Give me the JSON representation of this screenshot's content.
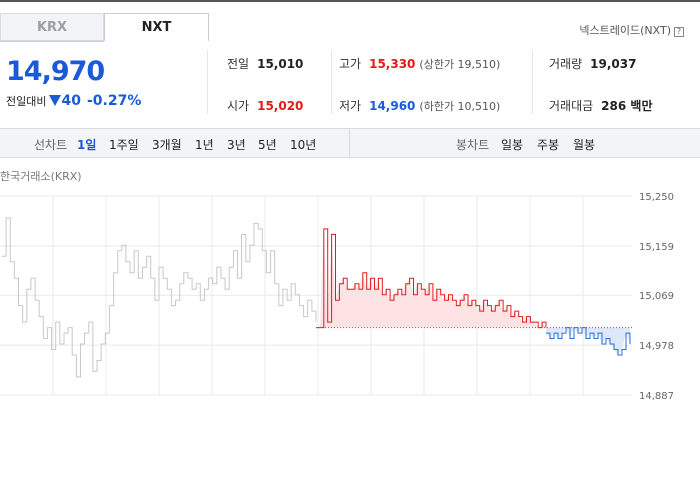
{
  "tabs": [
    {
      "label": "KRX",
      "active": false
    },
    {
      "label": "NXT",
      "active": true
    }
  ],
  "nxt_info_label": "넥스트레이드(NXT)",
  "help_icon_glyph": "?",
  "price": "14,970",
  "change": {
    "label": "전일대비",
    "amount": "40",
    "percent": "-0.27%",
    "direction": "down"
  },
  "stats": {
    "prev_close": {
      "label": "전일",
      "value": "15,010"
    },
    "high": {
      "label": "고가",
      "value": "15,330",
      "limit_label": "(상한가 19,510)"
    },
    "volume": {
      "label": "거래량",
      "value": "19,037"
    },
    "open": {
      "label": "시가",
      "value": "15,020"
    },
    "low": {
      "label": "저가",
      "value": "14,960",
      "limit_label": "(하한가 10,510)"
    },
    "amount": {
      "label": "거래대금",
      "value": "286 백만"
    }
  },
  "line_chart_menu": {
    "label": "선차트",
    "items": [
      {
        "label": "1일",
        "active": true
      },
      {
        "label": "1주일",
        "active": false
      },
      {
        "label": "3개월",
        "active": false
      },
      {
        "label": "1년",
        "active": false
      },
      {
        "label": "3년",
        "active": false
      },
      {
        "label": "5년",
        "active": false
      },
      {
        "label": "10년",
        "active": false
      }
    ]
  },
  "candle_chart_menu": {
    "label": "봉차트",
    "items": [
      {
        "label": "일봉"
      },
      {
        "label": "주봉"
      },
      {
        "label": "월봉"
      }
    ]
  },
  "chart_data": {
    "type": "line",
    "title": "한국거래소(KRX)",
    "ylim": [
      14887,
      15250
    ],
    "y_ticks": [
      "15,250",
      "15,159",
      "15,069",
      "14,978",
      "14,887"
    ],
    "y_tick_values": [
      15250,
      15159,
      15069,
      14978,
      14887
    ],
    "reference_price": 15010,
    "colors": {
      "krx": "#c8c8c8",
      "up": "#e21a1a",
      "down": "#2a6fd6",
      "up_fill": "#fde3e3",
      "down_fill": "#dde9f8",
      "grid": "#e9e9e9"
    },
    "series": [
      {
        "name": "",
        "values": [
          15140,
          15210,
          15130,
          15100,
          15050,
          15020,
          15080,
          15100,
          15060,
          15030,
          14990,
          15010,
          14970,
          15020,
          14980,
          15000,
          15010,
          14960,
          14920,
          14980,
          15000,
          15020,
          14930,
          14950,
          14980,
          15000,
          15050,
          15110,
          15150,
          15160,
          15130,
          15110,
          15150,
          15100,
          15120,
          15140,
          15100,
          15060,
          15120,
          15100,
          15080,
          15050,
          15060,
          15090,
          15110,
          15100,
          15080,
          15090,
          15060,
          15080,
          15100,
          15090,
          15120,
          15100,
          15080,
          15120,
          15150,
          15100,
          15180,
          15130,
          15160,
          15200,
          15190,
          15150,
          15110,
          15150,
          15090,
          15050,
          15080,
          15060,
          15090,
          15070,
          15050,
          15030,
          15060,
          15040,
          15020
        ]
      },
      {
        "name": "",
        "values": [
          15010,
          15010,
          15190,
          15020,
          15180,
          15060,
          15090,
          15100,
          15080,
          15080,
          15090,
          15080,
          15110,
          15080,
          15100,
          15080,
          15100,
          15070,
          15080,
          15060,
          15070,
          15080,
          15070,
          15090,
          15100,
          15070,
          15090,
          15080,
          15070,
          15090,
          15060,
          15080,
          15070,
          15060,
          15070,
          15060,
          15050,
          15060,
          15070,
          15050,
          15060,
          15050,
          15040,
          15060,
          15050,
          15040,
          15050,
          15060,
          15040,
          15050,
          15030,
          15040,
          15030,
          15020,
          15030,
          15020,
          15020,
          15010,
          15020,
          15010
        ]
      },
      {
        "name": "",
        "values": [
          15000,
          14990,
          15000,
          14990,
          15000,
          15010,
          14990,
          15010,
          15000,
          15010,
          14990,
          15000,
          14990,
          15000,
          14980,
          14990,
          14980,
          14970,
          14960,
          14970,
          15000,
          14980
        ]
      }
    ]
  }
}
